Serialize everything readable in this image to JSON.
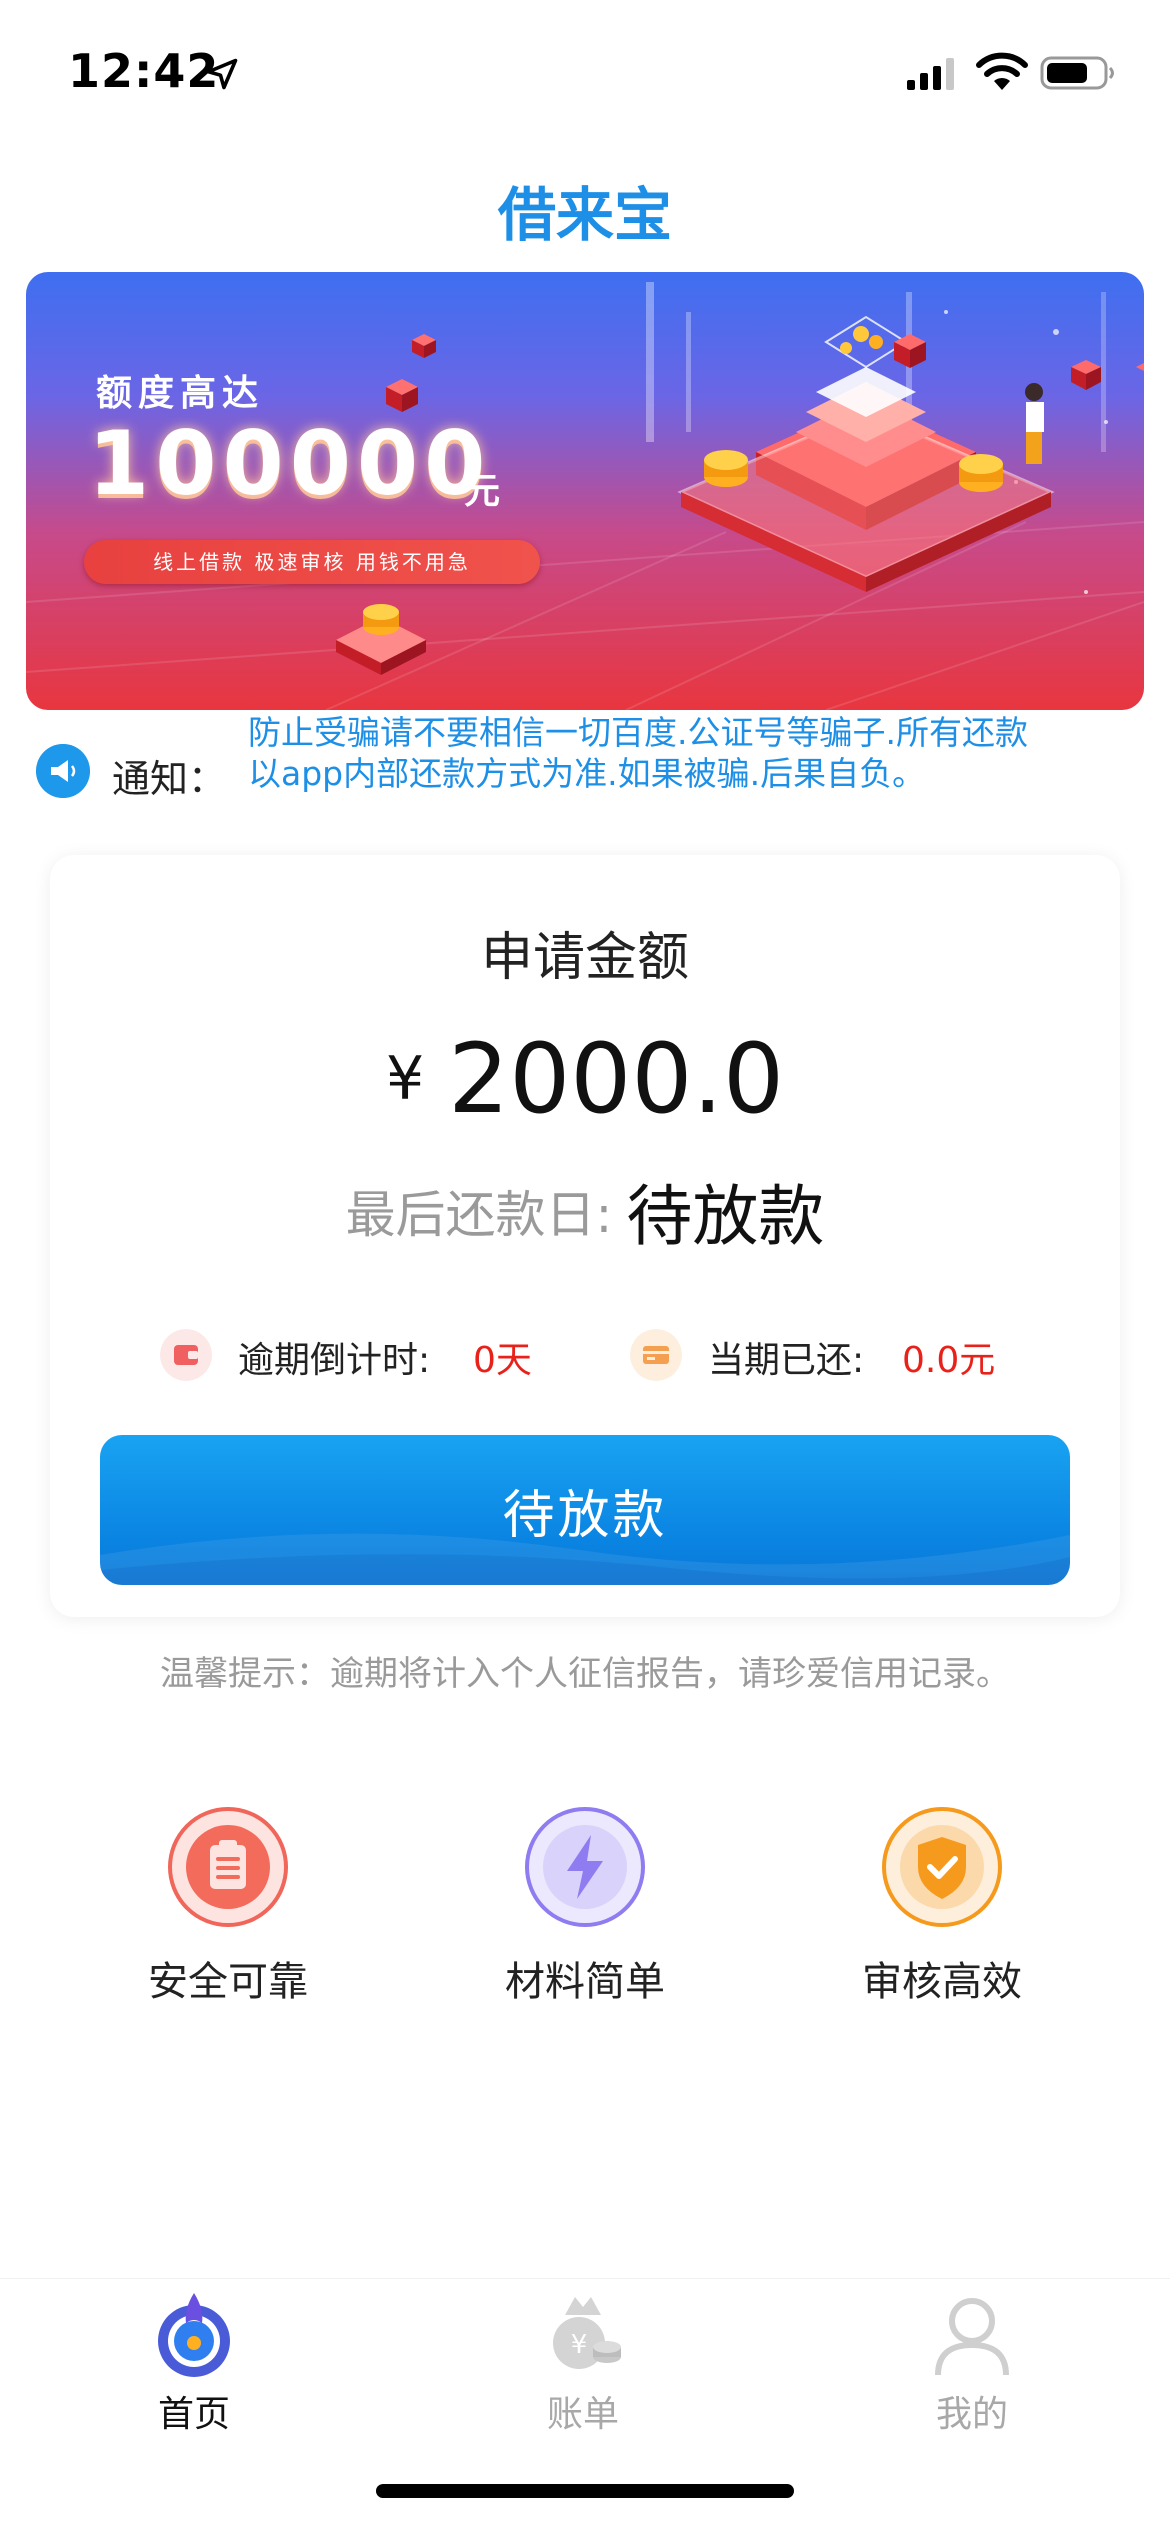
{
  "status_bar": {
    "time": "12:42"
  },
  "app": {
    "title": "借来宝"
  },
  "banner": {
    "subtitle": "额度高达",
    "amount": "100000",
    "unit": "元",
    "slogan": "线上借款  极速审核  用钱不用急"
  },
  "notice": {
    "label": "通知：",
    "text": "防止受骗请不要相信一切百度.公证号等骗子.所有还款以app内部还款方式为准.如果被骗.后果自负。"
  },
  "loan_card": {
    "title": "申请金额",
    "currency": "¥",
    "amount": "2000.0",
    "due_label": "最后还款日:",
    "due_value": "待放款",
    "overdue_label": "逾期倒计时:",
    "overdue_value": "0天",
    "repaid_label": "当期已还:",
    "repaid_value": "0.0元",
    "button_label": "待放款"
  },
  "tip": "温馨提示：逾期将计入个人征信报告，请珍爱信用记录。",
  "features": [
    {
      "label": "安全可靠",
      "icon": "clipboard-icon",
      "color": "#f0665a"
    },
    {
      "label": "材料简单",
      "icon": "lightning-icon",
      "color": "#8f7cf0"
    },
    {
      "label": "审核高效",
      "icon": "shield-check-icon",
      "color": "#f59a1d"
    }
  ],
  "tabs": [
    {
      "label": "首页",
      "icon": "home-icon",
      "active": true
    },
    {
      "label": "账单",
      "icon": "bill-icon",
      "active": false
    },
    {
      "label": "我的",
      "icon": "profile-icon",
      "active": false
    }
  ],
  "colors": {
    "brand": "#1e8fe6",
    "accent_red": "#e8221a",
    "muted": "#9a9a9a"
  }
}
